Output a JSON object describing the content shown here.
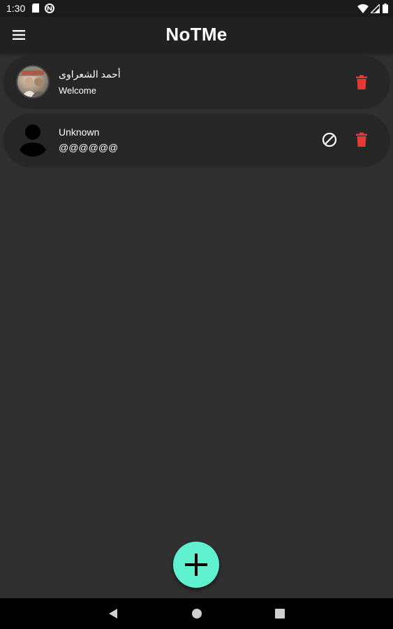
{
  "status_bar": {
    "time": "1:30",
    "icons": [
      "sim-card-icon",
      "nfc-icon",
      "wifi-icon",
      "signal-icon",
      "battery-icon"
    ]
  },
  "app_bar": {
    "title": "NoTMe",
    "menu_icon": "hamburger-menu-icon"
  },
  "contacts": [
    {
      "name": "أحمد الشعراوى",
      "message": "Welcome",
      "avatar": "photo",
      "actions": [
        "delete-icon"
      ]
    },
    {
      "name": "Unknown",
      "message": "@@@@@@",
      "avatar": "default-person-icon",
      "actions": [
        "block-icon",
        "delete-icon"
      ]
    }
  ],
  "fab": {
    "icon": "plus-icon"
  },
  "nav_bar": {
    "icons": [
      "back-icon",
      "home-icon",
      "recents-icon"
    ]
  },
  "colors": {
    "background": "#303030",
    "app_bar": "#212121",
    "card": "#262626",
    "accent": "#5ef0cf",
    "delete": "#e53935",
    "text": "#ffffff"
  }
}
